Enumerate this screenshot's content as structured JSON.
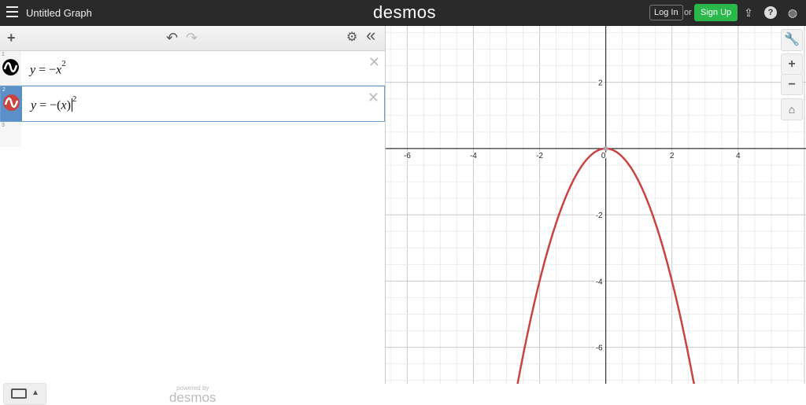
{
  "header": {
    "title": "Untitled Graph",
    "logo": "desmos",
    "login": "Log In",
    "or": "or",
    "signup": "Sign Up",
    "accent": "#2bb84a"
  },
  "toolbar": {
    "add": "+",
    "undo": "↶",
    "redo": "↷",
    "collapse": "«"
  },
  "expressions": [
    {
      "index": "1",
      "lhs": "y",
      "eq": " = −",
      "var": "x",
      "post": "",
      "exp": "2",
      "color": "#000000",
      "selected": false
    },
    {
      "index": "2",
      "lhs": "y",
      "eq": " = −(",
      "var": "x",
      "post": ")",
      "exp": "2",
      "color": "#c74440",
      "selected": true
    },
    {
      "index": "3"
    }
  ],
  "footer": {
    "powered_by": "powered by",
    "brand": "desmos"
  },
  "graph_controls": {
    "zoom_in": "+",
    "zoom_out": "−"
  },
  "graph": {
    "x_ticks": [
      "-6",
      "-4",
      "-2",
      "0",
      "2",
      "4"
    ],
    "y_ticks": [
      "2",
      "-2",
      "-4",
      "-6"
    ],
    "curve": "y=-x^2",
    "curve_color": "#c74440",
    "xrange": [
      -6.65,
      6.05
    ],
    "yrange": [
      -7.1,
      3.7
    ]
  }
}
